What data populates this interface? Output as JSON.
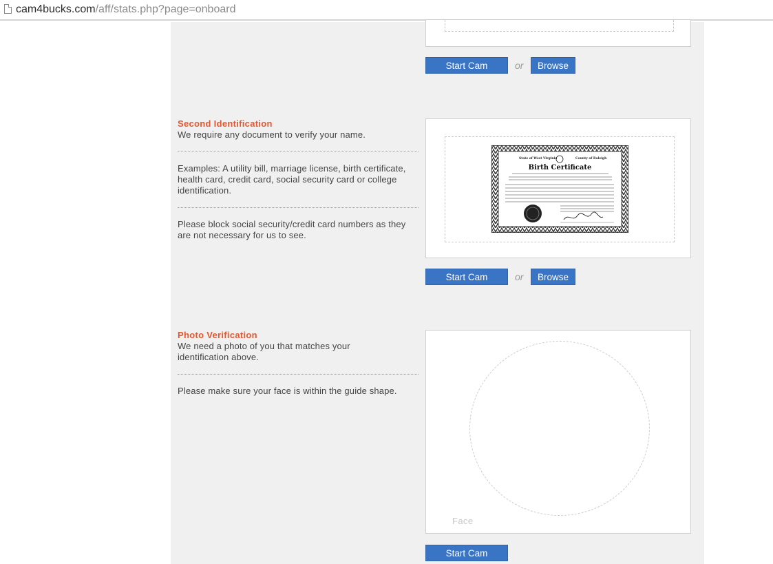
{
  "browser": {
    "url_host": "cam4bucks.com",
    "url_path": "/aff/stats.php?page=onboard"
  },
  "first_id": {
    "start_cam_label": "Start Cam",
    "or_text": "or",
    "browse_label": "Browse"
  },
  "second_id": {
    "title": "Second Identification",
    "subtitle": "We require any document to verify your name.",
    "examples": "Examples: A utility bill, marriage license, birth certificate, health card, credit card, social security card or college identification.",
    "note": "Please block social security/credit card numbers as they are not necessary for us to see.",
    "start_cam_label": "Start Cam",
    "or_text": "or",
    "browse_label": "Browse",
    "sample": {
      "header_left": "State of West Virginia",
      "header_right": "County of Raleigh",
      "title": "Birth Certificate"
    }
  },
  "photo": {
    "title": "Photo Verification",
    "subtitle": "We need a photo of you that matches your identification above.",
    "note": "Please make sure your face is within the guide shape.",
    "face_label": "Face",
    "start_cam_label": "Start Cam"
  },
  "colors": {
    "accent_orange": "#e4572e",
    "button_blue": "#3a74c4",
    "panel_gray": "#f0f0f0"
  }
}
